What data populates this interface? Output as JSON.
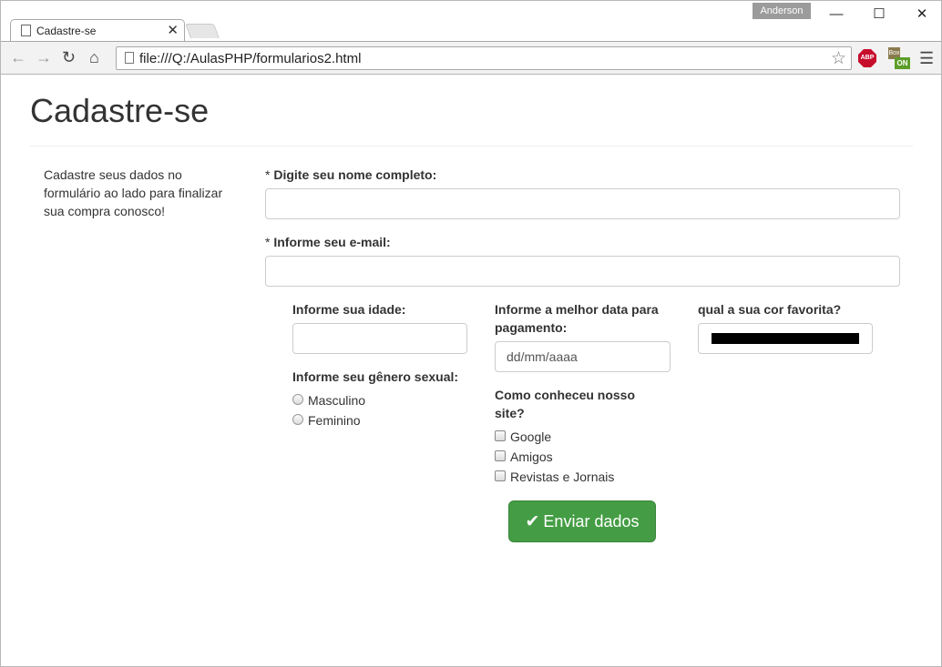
{
  "browser": {
    "tab_title": "Cadastre-se",
    "tab_close": "✕",
    "user": "Anderson",
    "url": "file:///Q:/AulasPHP/formularios2.html",
    "abp_label": "ABP",
    "boxon_top": "Box",
    "boxon_bottom": "ON"
  },
  "page": {
    "title": "Cadastre-se",
    "aside": "Cadastre seus dados no formulário ao lado para finalizar sua compra conosco!"
  },
  "form": {
    "name_label": "Digite seu nome completo:",
    "email_label": "Informe seu e-mail:",
    "required_mark": "* ",
    "age_label": "Informe sua idade:",
    "date_label": "Informe a melhor data para pagamento:",
    "date_placeholder": "dd/mm/aaaa",
    "color_label": "qual a sua cor favorita?",
    "color_value": "#000000",
    "gender_label": "Informe seu gênero sexual:",
    "gender_options": [
      "Masculino",
      "Feminino"
    ],
    "source_label": "Como conheceu nosso site?",
    "source_options": [
      "Google",
      "Amigos",
      "Revistas e Jornais"
    ],
    "submit_label": "Enviar dados"
  },
  "colors": {
    "submit_bg": "#449d44",
    "abp_red": "#c70d2c"
  }
}
